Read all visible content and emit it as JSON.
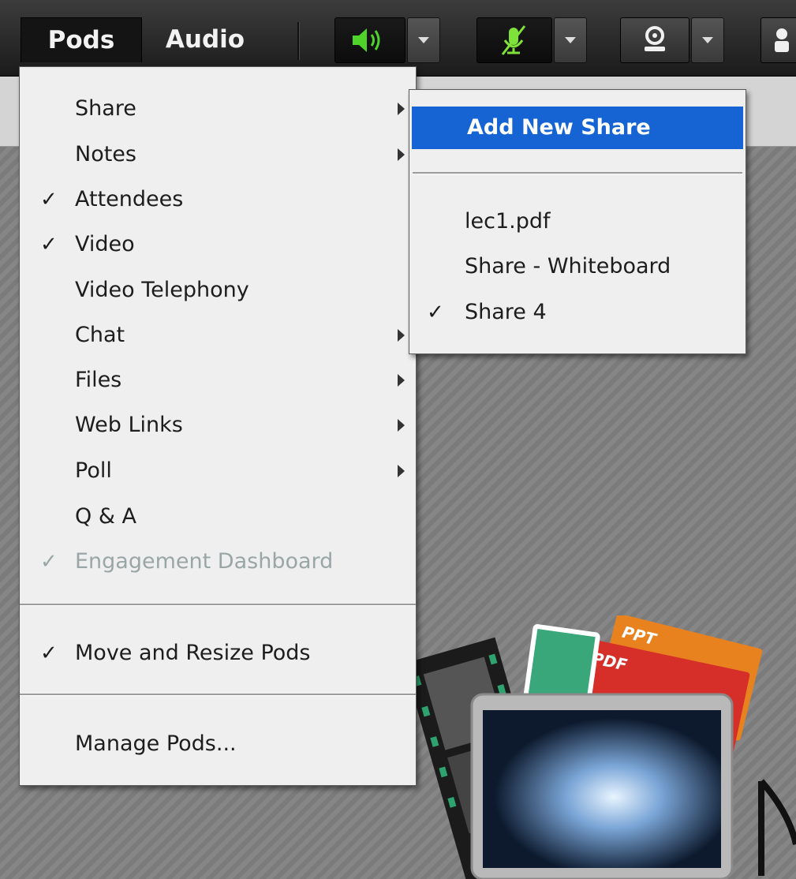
{
  "menubar": {
    "items": [
      {
        "label": "Pods"
      },
      {
        "label": "Audio"
      }
    ],
    "speaker_color": "#4fd32a",
    "mic_color": "#7fe23a"
  },
  "pods_menu": {
    "items": [
      {
        "label": "Share",
        "checked": false,
        "submenu": true
      },
      {
        "label": "Notes",
        "checked": false,
        "submenu": true
      },
      {
        "label": "Attendees",
        "checked": true,
        "submenu": false
      },
      {
        "label": "Video",
        "checked": true,
        "submenu": false
      },
      {
        "label": "Video Telephony",
        "checked": false,
        "submenu": false
      },
      {
        "label": "Chat",
        "checked": false,
        "submenu": true
      },
      {
        "label": "Files",
        "checked": false,
        "submenu": true
      },
      {
        "label": "Web Links",
        "checked": false,
        "submenu": true
      },
      {
        "label": "Poll",
        "checked": false,
        "submenu": true
      },
      {
        "label": "Q & A",
        "checked": false,
        "submenu": false
      },
      {
        "label": "Engagement Dashboard",
        "checked": true,
        "disabled": true
      }
    ],
    "move_resize": {
      "label": "Move and Resize Pods",
      "checked": true
    },
    "manage": {
      "label": "Manage Pods..."
    },
    "check_glyph": "✓"
  },
  "share_submenu": {
    "add_new": "Add New Share",
    "items": [
      {
        "label": "lec1.pdf",
        "checked": false
      },
      {
        "label": "Share - Whiteboard",
        "checked": false
      },
      {
        "label": "Share 4",
        "checked": true
      }
    ],
    "highlight_color": "#1664d4"
  },
  "graphic": {
    "ppt_label": "PPT",
    "pdf_label": "PDF"
  }
}
